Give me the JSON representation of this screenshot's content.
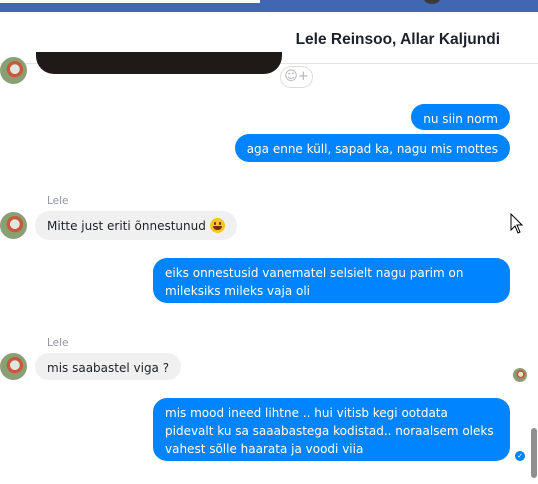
{
  "header": {
    "title": "Lele Reinsoo, Allar Kaljundi"
  },
  "messages": [
    {
      "text": "nu siin norm"
    },
    {
      "text": "aga enne küll, sapad ka, nagu mis mottes"
    },
    {
      "sender": "Lele",
      "text": "Mitte just eriti õnnestunud"
    },
    {
      "text": "eiks onnestusid vanematel selsielt nagu parim on mileksiks mileks vaja oli"
    },
    {
      "sender": "Lele",
      "text": "mis saabastel viga ?"
    },
    {
      "text": "mis mood ineed lihtne .. hui vitisb kegi ootdata pidevalt ku sa saaabastega kodistad.. noraalsem oleks vahest sõlle haarata ja voodi viia"
    }
  ],
  "colors": {
    "outgoing": "#0084ff",
    "incoming": "#f1f0f0",
    "topbar": "#4267b2"
  },
  "icons": {
    "react": "smiley-plus-icon",
    "emoji": "grinning-face-icon",
    "seen": "check-circle-icon"
  }
}
